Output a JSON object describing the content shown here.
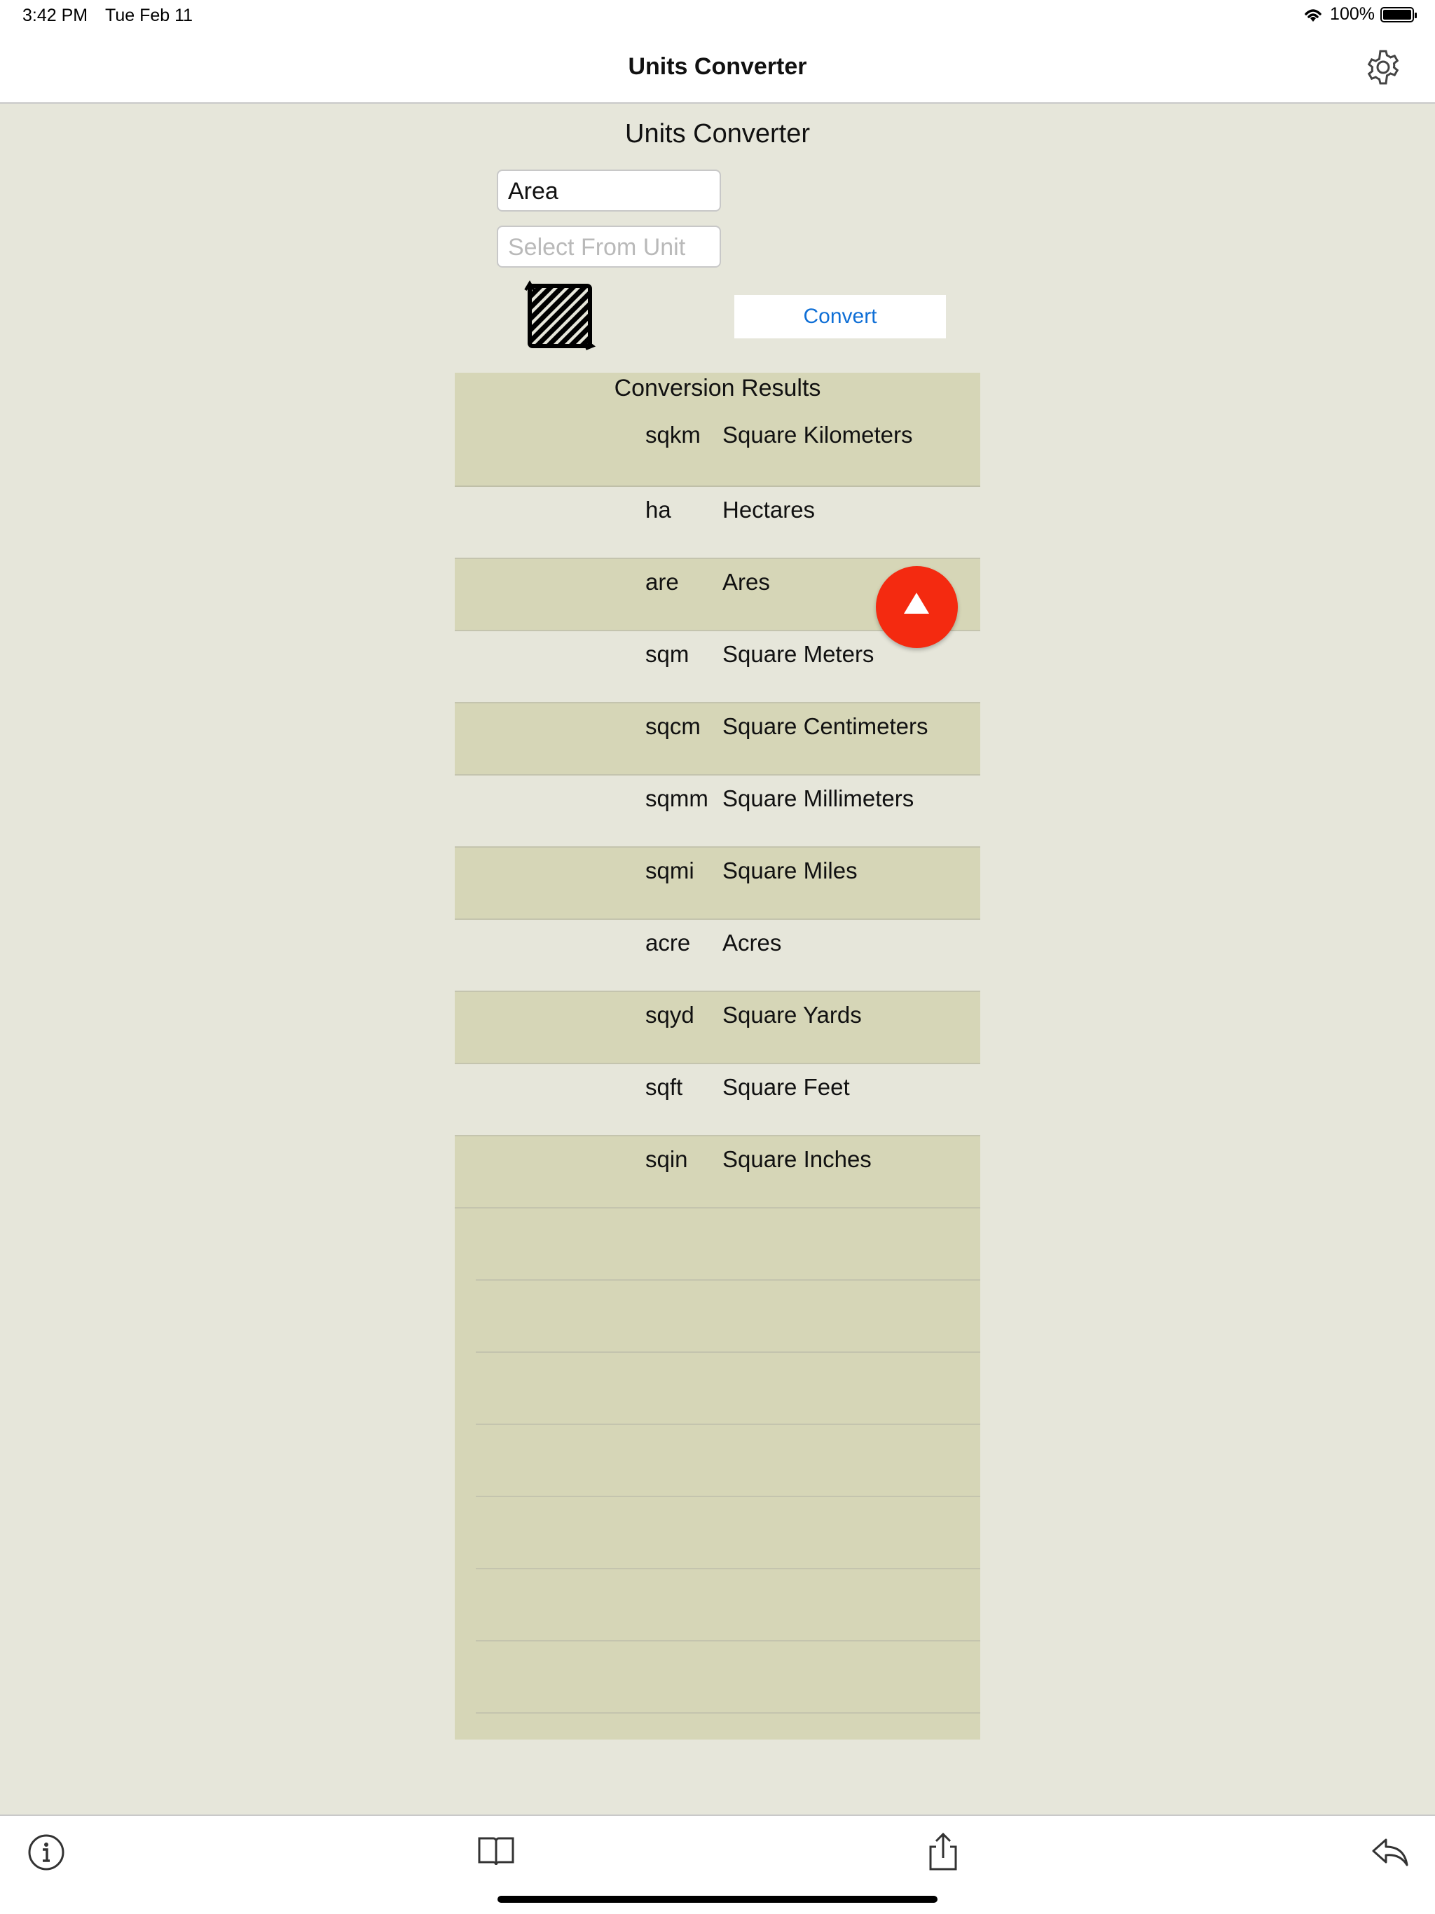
{
  "status_bar": {
    "time": "3:42 PM",
    "date": "Tue Feb 11",
    "battery": "100%"
  },
  "nav": {
    "title": "Units Converter",
    "settings_icon": "gear-icon"
  },
  "page": {
    "title": "Units Converter",
    "category_value": "Area",
    "from_unit_placeholder": "Select From Unit",
    "convert_label": "Convert",
    "category_icon": "area-hatched-square-icon"
  },
  "results": {
    "title": "Conversion Results",
    "rows": [
      {
        "symbol": "sqkm",
        "name": "Square Kilometers"
      },
      {
        "symbol": "ha",
        "name": "Hectares"
      },
      {
        "symbol": "are",
        "name": "Ares"
      },
      {
        "symbol": "sqm",
        "name": "Square Meters"
      },
      {
        "symbol": "sqcm",
        "name": "Square Centimeters"
      },
      {
        "symbol": "sqmm",
        "name": "Square Millimeters"
      },
      {
        "symbol": "sqmi",
        "name": "Square Miles"
      },
      {
        "symbol": "acre",
        "name": "Acres"
      },
      {
        "symbol": "sqyd",
        "name": "Square Yards"
      },
      {
        "symbol": "sqft",
        "name": "Square Feet"
      },
      {
        "symbol": "sqin",
        "name": "Square Inches"
      }
    ]
  },
  "fab": {
    "icon": "arrow-up-icon",
    "color": "#f42a10"
  },
  "toolbar": {
    "items": [
      "info-icon",
      "book-icon",
      "share-icon",
      "reply-icon"
    ]
  },
  "colors": {
    "background": "#e6e6da",
    "row_shaded": "#d6d6b7",
    "accent": "#0f6fd6"
  }
}
